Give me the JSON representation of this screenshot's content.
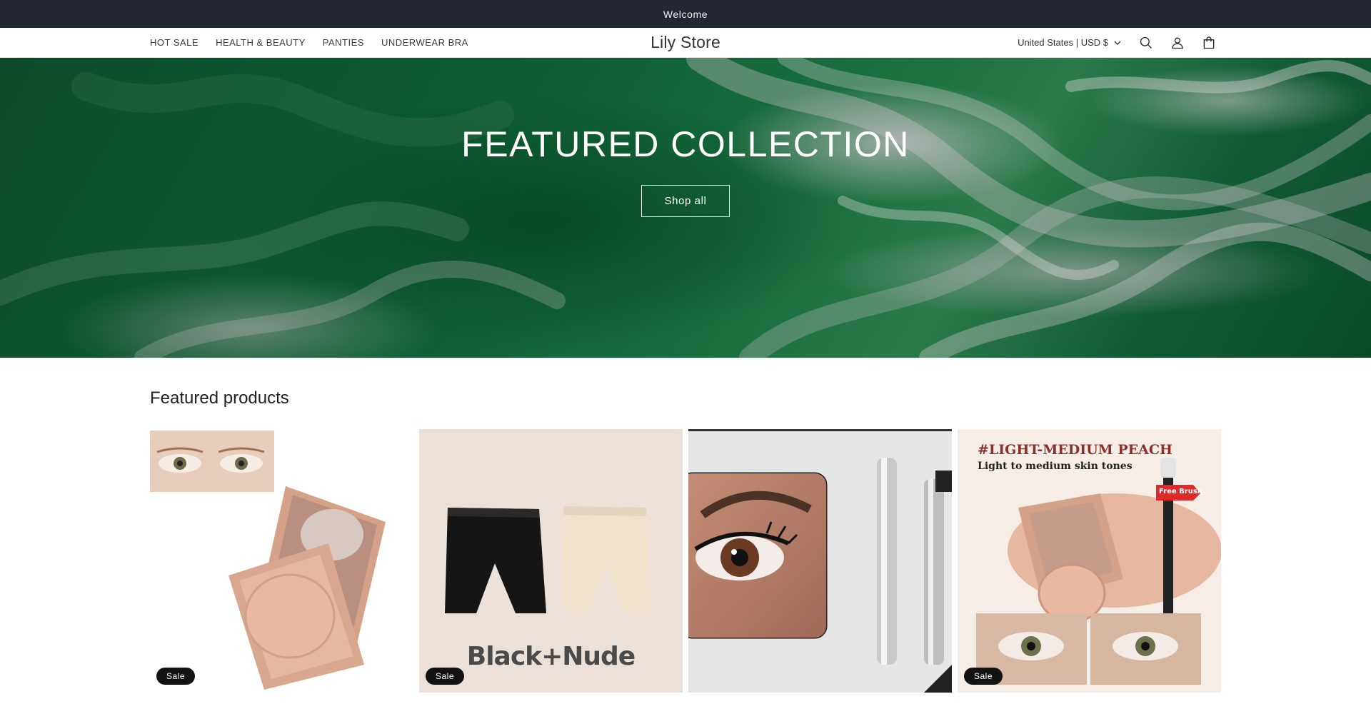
{
  "announcement": {
    "text": "Welcome"
  },
  "header": {
    "nav": [
      "HOT SALE",
      "HEALTH & BEAUTY",
      "PANTIES",
      "UNDERWEAR BRA"
    ],
    "brand": "Lily Store",
    "locale": "United States | USD $",
    "icons": [
      "search-icon",
      "account-icon",
      "cart-icon"
    ]
  },
  "hero": {
    "title": "FEATURED COLLECTION",
    "button": "Shop all"
  },
  "featured": {
    "title": "Featured products",
    "products": [
      {
        "badge": "Sale",
        "image": "compact-concealer"
      },
      {
        "badge": "Sale",
        "image": "safety-shorts",
        "image_text": "Black+Nude"
      },
      {
        "badge": "",
        "image": "mascara"
      },
      {
        "badge": "Sale",
        "image": "concealer-peach",
        "image_text": "#LIGHT-MEDIUM PEACH",
        "image_subtext": "Light to medium skin tones",
        "tag": "Free Brush"
      }
    ]
  },
  "colors": {
    "announcement_bg": "#232734",
    "hero_green": "#0b5a31",
    "badge_bg": "#121212"
  }
}
